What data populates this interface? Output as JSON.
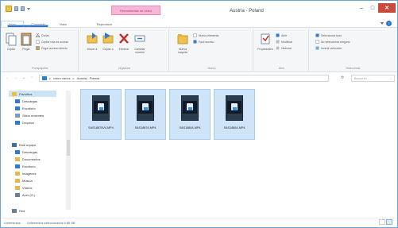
{
  "window": {
    "title": "Austria - Poland",
    "context_tab": "Herramientas de vídeo"
  },
  "caption": {
    "minimize": "–",
    "maximize": "□",
    "close": "✕"
  },
  "tabs": [
    "Archivo",
    "Inicio",
    "Compartir",
    "Vista",
    "Reproducir"
  ],
  "ribbon": {
    "clipboard": {
      "label": "Portapapeles",
      "copy": "Copiar",
      "paste": "Pegar",
      "cut": "Cortar",
      "copy_path": "Copiar ruta de acceso",
      "paste_shortcut": "Pegar acceso directo"
    },
    "organize": {
      "label": "Organizar",
      "move_to": "Mover a",
      "copy_to": "Copiar a",
      "delete": "Eliminar",
      "rename": "Cambiar nombre"
    },
    "new": {
      "label": "Nuevo",
      "new_folder": "Nueva carpeta",
      "new_item": "Nuevo elemento",
      "easy_access": "Fácil acceso"
    },
    "open": {
      "label": "Abrir",
      "properties": "Propiedades",
      "open": "Abrir",
      "edit": "Modificar",
      "history": "Historial"
    },
    "select": {
      "label": "Seleccionar",
      "select_all": "Seleccionar todo",
      "select_none": "No seleccionar ninguno",
      "invert": "Invertir selección"
    }
  },
  "address": {
    "crumbs": [
      "vídeo varios",
      "Austria - Poland"
    ],
    "search_placeholder": "Buscar en ..."
  },
  "nav": {
    "items": [
      {
        "label": "Favoritos",
        "icon": "star-icon",
        "color": "#f0c030"
      },
      {
        "label": "Descargas",
        "icon": "download-folder-icon",
        "color": "#2e7bd1"
      },
      {
        "label": "Escritorio",
        "icon": "desktop-icon",
        "color": "#2e7bd1"
      },
      {
        "label": "Sitios recientes",
        "icon": "recent-icon",
        "color": "#7a9ab8"
      },
      {
        "label": "Dropbox",
        "icon": "dropbox-icon",
        "color": "#2e7bd1"
      },
      {
        "label": "Este equipo",
        "icon": "computer-icon",
        "color": "#3a6ea5"
      },
      {
        "label": "Descargas",
        "icon": "download-folder-icon",
        "color": "#2e7bd1"
      },
      {
        "label": "Documentos",
        "icon": "documents-icon",
        "color": "#e6b84a"
      },
      {
        "label": "Escritorio",
        "icon": "desktop-icon",
        "color": "#2e7bd1"
      },
      {
        "label": "Imágenes",
        "icon": "pictures-icon",
        "color": "#e6b84a"
      },
      {
        "label": "Música",
        "icon": "music-icon",
        "color": "#e6b84a"
      },
      {
        "label": "Vídeos",
        "icon": "videos-icon",
        "color": "#e6b84a"
      },
      {
        "label": "Acer (C:)",
        "icon": "drive-icon",
        "color": "#6a7f95"
      },
      {
        "label": "Red",
        "icon": "network-icon",
        "color": "#6a7f95"
      }
    ]
  },
  "files": [
    {
      "name": "SAS18875V4.MP4"
    },
    {
      "name": "SAS18876.MP4"
    },
    {
      "name": "SAS18884.MP4"
    },
    {
      "name": "SAS18884.MP4"
    }
  ],
  "status": {
    "count": "4 elementos",
    "selection": "4 elementos seleccionados  5,85 GB"
  },
  "colors": {
    "accent": "#2a73c8",
    "selection": "#cfe4f8",
    "close": "#c94a3a"
  }
}
